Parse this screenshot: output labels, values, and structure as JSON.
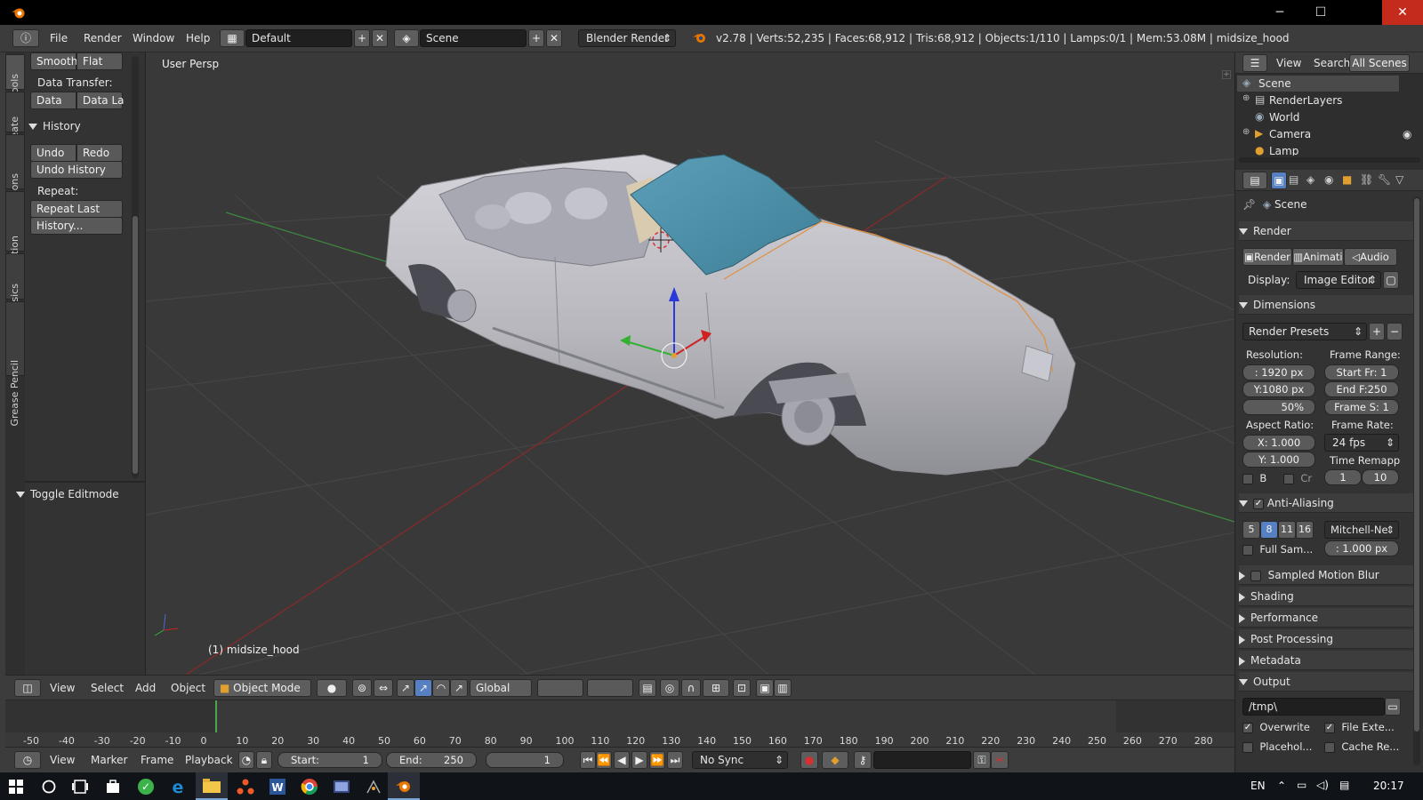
{
  "window": {
    "close_label": "✕"
  },
  "infobar": {
    "menus": [
      "File",
      "Render",
      "Window",
      "Help"
    ],
    "screen_layout": "Default",
    "scene": "Scene",
    "engine": "Blender Render",
    "stats": "v2.78 | Verts:52,235 | Faces:68,912 | Tris:68,912 | Objects:1/110 | Lamps:0/1 | Mem:53.08M | midsize_hood"
  },
  "toolshelf": {
    "tabs": [
      "Tools",
      "Create",
      "Relations",
      "Animation",
      "Physics",
      "Grease Pencil"
    ],
    "shading_smooth": "Smooth",
    "shading_flat": "Flat",
    "data_transfer_label": "Data Transfer:",
    "data_btn": "Data",
    "data_layout_btn": "Data La",
    "history_header": "History",
    "undo": "Undo",
    "redo": "Redo",
    "undo_history": "Undo History",
    "repeat_label": "Repeat:",
    "repeat_last": "Repeat Last",
    "history_btn": "History...",
    "toggle_editmode": "Toggle Editmode"
  },
  "viewport": {
    "view_name": "User Persp",
    "object_label": "(1) midsize_hood",
    "colors": {
      "body": "#b9b9bf",
      "glass": "#4e8ea6",
      "grid": "#474747",
      "x_axis": "#8a2a2a",
      "y_axis": "#3f8a3f"
    }
  },
  "view3d_header": {
    "menus": [
      "View",
      "Select",
      "Add",
      "Object"
    ],
    "mode": "Object Mode",
    "orientation": "Global"
  },
  "timeline": {
    "ticks": [
      "-50",
      "-40",
      "-30",
      "-20",
      "-10",
      "0",
      "10",
      "20",
      "30",
      "40",
      "50",
      "60",
      "70",
      "80",
      "90",
      "100",
      "110",
      "120",
      "130",
      "140",
      "150",
      "160",
      "170",
      "180",
      "190",
      "200",
      "210",
      "220",
      "230",
      "240",
      "250",
      "260",
      "270",
      "280"
    ],
    "menus": [
      "View",
      "Marker",
      "Frame",
      "Playback"
    ],
    "start_label": "Start:",
    "start_value": "1",
    "end_label": "End:",
    "end_value": "250",
    "current_frame": "1",
    "sync": "No Sync"
  },
  "outliner": {
    "menus": [
      "View",
      "Search"
    ],
    "filter": "All Scenes",
    "items": [
      "Scene",
      "RenderLayers",
      "World",
      "Camera",
      "Lamp"
    ]
  },
  "properties": {
    "context": "Scene",
    "render_header": "Render",
    "render_btn": "Render",
    "anim_btn": "Animati",
    "audio_btn": "Audio",
    "display_label": "Display:",
    "display_value": "Image Editor",
    "dimensions_header": "Dimensions",
    "render_presets": "Render Presets",
    "resolution_label": "Resolution:",
    "res_x": ": 1920 px",
    "res_y": "Y:1080 px",
    "res_pct": "50%",
    "frame_range_label": "Frame Range:",
    "start_fr": "Start Fr:  1",
    "end_f": "End F:250",
    "frame_s": "Frame S: 1",
    "aspect_label": "Aspect Ratio:",
    "aspect_x": "X:  1.000",
    "aspect_y": "Y:  1.000",
    "frame_rate_label": "Frame Rate:",
    "fps": "24 fps",
    "time_remap_label": "Time Remapp",
    "border": "B",
    "crop": "Cr",
    "remap_old": "1",
    "remap_new": "10",
    "aa_header": "Anti-Aliasing",
    "aa_samples": [
      "5",
      "8",
      "11",
      "16"
    ],
    "aa_filter": "Mitchell-Ne",
    "full_sample": "Full Sam...",
    "filter_size": ": 1.000 px",
    "collapsed": [
      "Sampled Motion Blur",
      "Shading",
      "Performance",
      "Post Processing",
      "Metadata"
    ],
    "output_header": "Output",
    "output_path": "/tmp\\",
    "overwrite": "Overwrite",
    "file_ext": "File Exte...",
    "placeholders": "Placehol...",
    "cache_result": "Cache Re..."
  },
  "taskbar": {
    "lang": "EN",
    "time": "20:17"
  }
}
